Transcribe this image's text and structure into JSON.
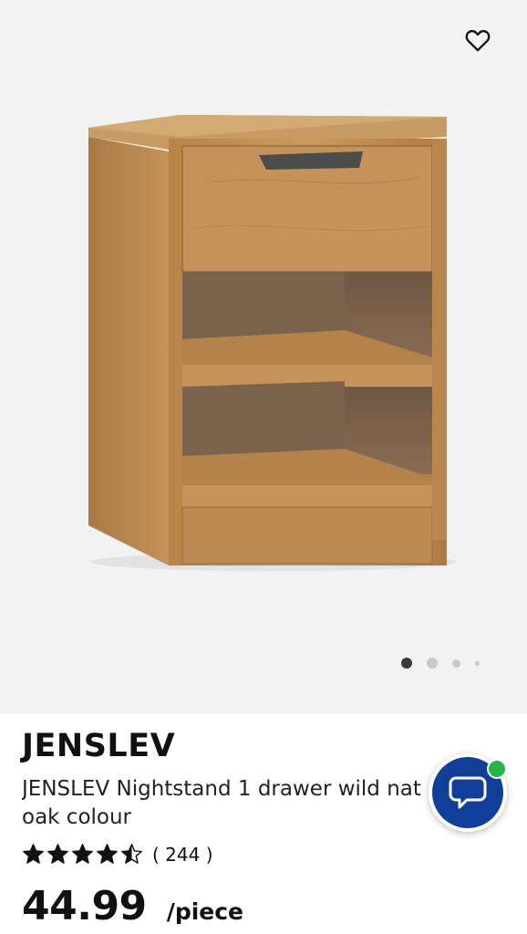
{
  "product": {
    "brand": "JENSLEV",
    "description_line1": "JENSLEV Nightstand 1 drawer wild nat",
    "description_line2": "oak colour",
    "rating": 4.5,
    "reviews": "( 244 )",
    "price": "44.99",
    "unit": "/piece"
  },
  "gallery": {
    "image_count": 4,
    "active_index": 0,
    "image_subject": "oak-nightstand"
  },
  "icons": {
    "favorite": "heart-outline-icon",
    "chat": "chat-bubble-icon",
    "star": "star-icon"
  },
  "colors": {
    "chat_button": "#103f9a",
    "online_indicator": "#25b54a",
    "active_dot": "#3a3a3a",
    "inactive_dot": "#c8c8c8"
  }
}
